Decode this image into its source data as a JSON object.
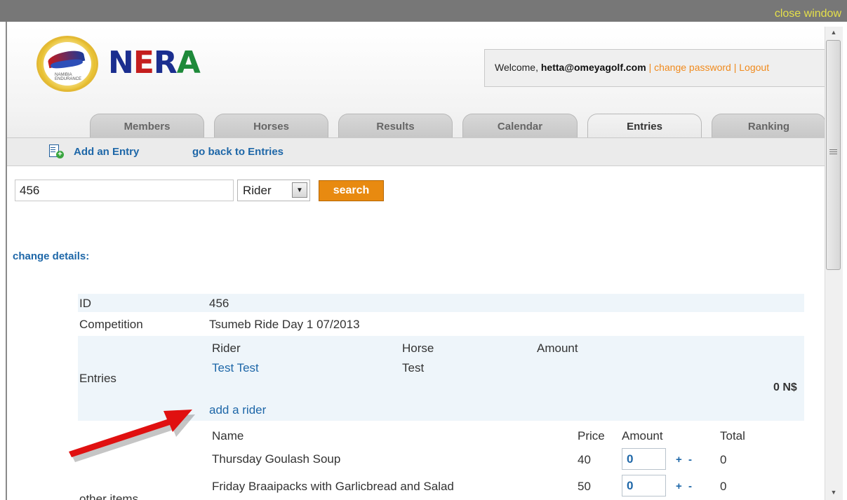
{
  "window": {
    "close_label": "close window"
  },
  "brand": {
    "name": "NERA",
    "logo_caption": "NAMIBIA ENDURANCE"
  },
  "account": {
    "welcome_prefix": "Welcome,",
    "user_email": "hetta@omeyagolf.com",
    "separator": "|",
    "change_password": "change password",
    "logout": "Logout"
  },
  "tabs": [
    {
      "label": "Members"
    },
    {
      "label": "Horses"
    },
    {
      "label": "Results"
    },
    {
      "label": "Calendar"
    },
    {
      "label": "Entries",
      "active": true
    },
    {
      "label": "Ranking"
    }
  ],
  "subnav": {
    "add_entry": "Add an Entry",
    "back": "go back to Entries"
  },
  "search": {
    "value": "456",
    "type_selected": "Rider",
    "button": "search"
  },
  "details": {
    "heading": "change details:",
    "id_label": "ID",
    "id_value": "456",
    "competition_label": "Competition",
    "competition_value": "Tsumeb Ride Day 1 07/2013",
    "entries_label": "Entries",
    "entries_headers": [
      "Rider",
      "Horse",
      "Amount"
    ],
    "entries_rows": [
      {
        "rider": "Test Test",
        "horse": "Test"
      }
    ],
    "entries_total": "0 N$",
    "add_rider": "add a rider",
    "other_items_label": "other items",
    "items_headers": [
      "Name",
      "Price",
      "Amount",
      "Total"
    ],
    "items": [
      {
        "name": "Thursday Goulash Soup",
        "price": "40",
        "amount": "0",
        "plus": "+",
        "minus": "-",
        "total": "0"
      },
      {
        "name": "Friday Braaipacks with Garlicbread and Salad",
        "price": "50",
        "amount": "0",
        "plus": "+",
        "minus": "-",
        "total": "0"
      }
    ]
  },
  "colors": {
    "accent_orange": "#e88a10",
    "link_blue": "#1e67a8",
    "row_tint": "#eef5fa",
    "arrow_red": "#e01010"
  }
}
